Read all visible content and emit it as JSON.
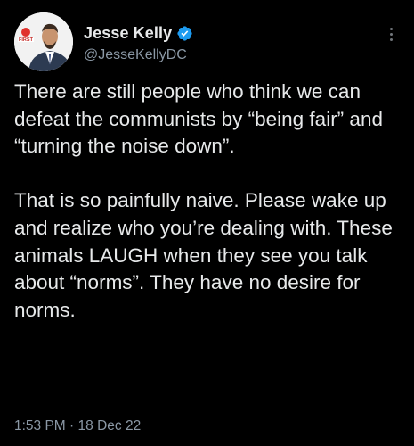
{
  "author": {
    "display_name": "Jesse Kelly",
    "handle": "@JesseKellyDC",
    "verified": true,
    "avatar_badge_text": "FIRST",
    "verified_icon": "verified-badge-icon",
    "verified_color": "#1d9bf0"
  },
  "menu": {
    "icon": "more-options-icon"
  },
  "tweet": {
    "text": "There are still people who think we can defeat the communists by “being fair” and “turning the noise down”.\n\nThat is so painfully naive. Please wake up and realize who you’re dealing with. These animals LAUGH when they see you talk about “norms”. They have no desire for norms.",
    "time": "1:53 PM",
    "separator": "·",
    "date": "18 Dec 22"
  },
  "colors": {
    "background": "#000000",
    "primary_text": "#e7e9ea",
    "secondary_text": "#8b98a5"
  }
}
